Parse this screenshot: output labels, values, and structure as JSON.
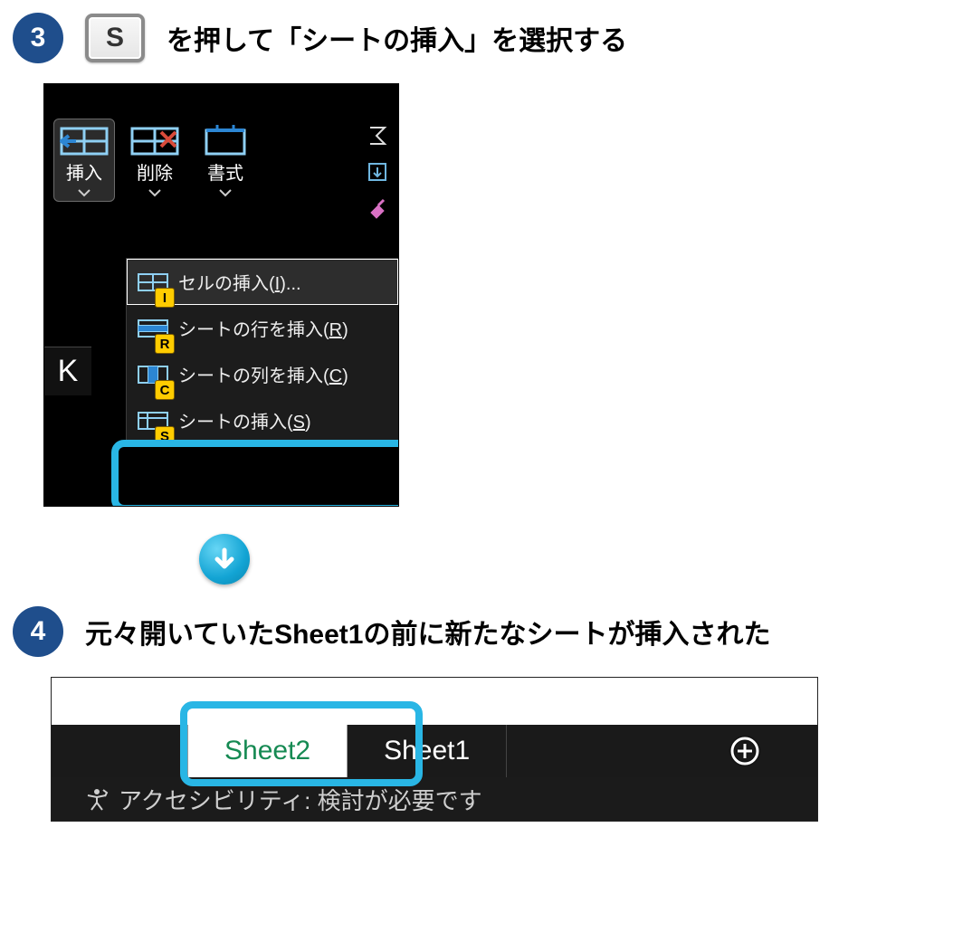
{
  "steps": {
    "s3": {
      "num": "3",
      "key": "S",
      "text": "を押して「シートの挿入」を選択する"
    },
    "s4": {
      "num": "4",
      "text": "元々開いていたSheet1の前に新たなシートが挿入された"
    }
  },
  "ribbon": {
    "insert": "挿入",
    "delete": "削除",
    "format": "書式",
    "side_k": "K"
  },
  "menu": {
    "items": [
      {
        "label_pre": "セルの挿入(",
        "accel": "I",
        "label_post": ")...",
        "keytip": "I"
      },
      {
        "label_pre": "シートの行を挿入(",
        "accel": "R",
        "label_post": ")",
        "keytip": "R"
      },
      {
        "label_pre": "シートの列を挿入(",
        "accel": "C",
        "label_post": ")",
        "keytip": "C"
      },
      {
        "label_pre": "シートの挿入(",
        "accel": "S",
        "label_post": ")",
        "keytip": "S"
      }
    ]
  },
  "tabs": {
    "active": "Sheet2",
    "inactive": "Sheet1"
  },
  "status": "アクセシビリティ: 検討が必要です"
}
